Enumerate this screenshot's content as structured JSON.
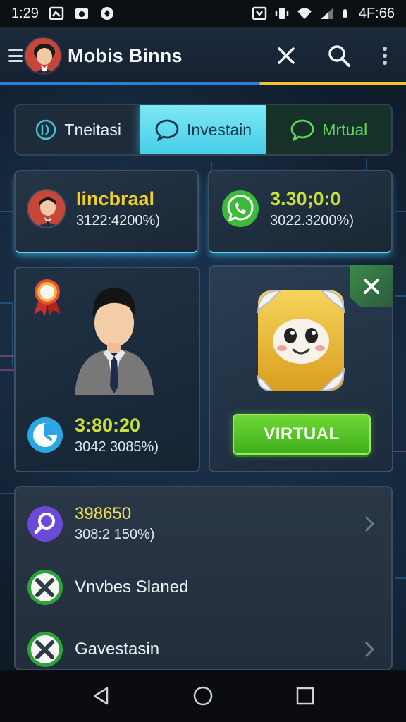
{
  "status_bar": {
    "time": "1:29",
    "right_text": "4F:66"
  },
  "app_bar": {
    "title": "Mobis Binns"
  },
  "tabs": [
    {
      "label": "Tneitasi"
    },
    {
      "label": "Investain"
    },
    {
      "label": "Mrtual"
    }
  ],
  "stat_cards": [
    {
      "title": "Iincbraal",
      "subtitle": "3122:4200%)"
    },
    {
      "title": "3.30;0:0",
      "subtitle": "3022.3200%)"
    }
  ],
  "profile_card": {
    "timer_value": "3:80:20",
    "timer_subtitle": "3042 3085%)"
  },
  "virtual_card": {
    "button_label": "VIRTUAL"
  },
  "list": [
    {
      "title": "398650",
      "subtitle": "308:2 150%)"
    },
    {
      "label": "Vnvbes Slaned"
    },
    {
      "label": "Gavestasin"
    }
  ],
  "colors": {
    "accent_cyan": "#46cde8",
    "accent_green": "#3fae1c",
    "accent_yellow": "#f1cf2a"
  }
}
